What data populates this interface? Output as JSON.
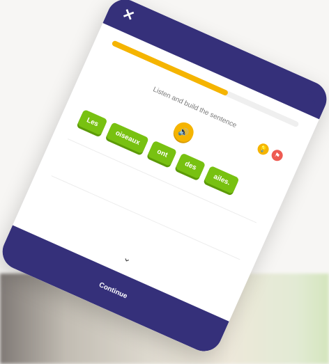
{
  "header": {
    "close_icon": "close-icon",
    "expand_icon": "expand-icon"
  },
  "exercise": {
    "progress": 0.62,
    "instruction": "Listen and build the sentence",
    "hint_icon": "lightbulb-icon",
    "flag_icon": "flag-icon",
    "audio_icon": "speaker-icon",
    "words": [
      "Les",
      "oiseaux",
      "ont",
      "des",
      "ailes."
    ]
  },
  "footer": {
    "continue_label": "Continue",
    "chevron_icon": "chevron-down-icon"
  },
  "colors": {
    "header": "#35307a",
    "accent": "#f5b400",
    "tile": "#78c111",
    "flag": "#ee5b52"
  }
}
